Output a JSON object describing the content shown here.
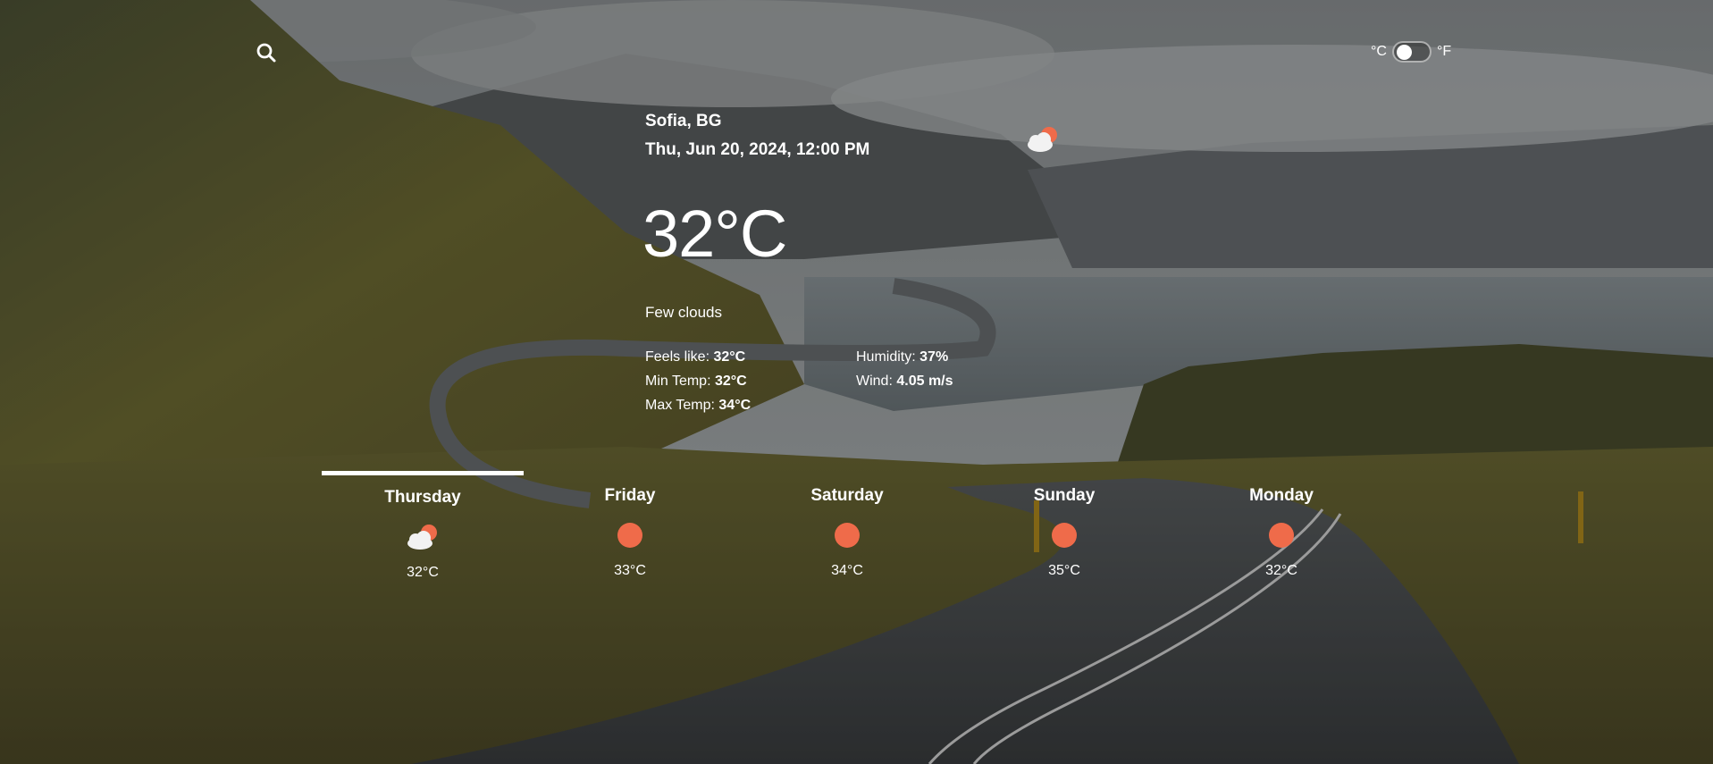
{
  "search": {
    "icon": "search-icon"
  },
  "units": {
    "celsius_label": "°C",
    "fahrenheit_label": "°F",
    "selected": "°C"
  },
  "current": {
    "location": "Sofia, BG",
    "datetime": "Thu, Jun 20, 2024, 12:00 PM",
    "icon": "sun-behind-cloud-icon",
    "temperature": "32°C",
    "description": "Few clouds",
    "details": {
      "feels_like_label": "Feels like:",
      "feels_like_value": "32°C",
      "min_temp_label": "Min Temp:",
      "min_temp_value": "32°C",
      "max_temp_label": "Max Temp:",
      "max_temp_value": "34°C",
      "humidity_label": "Humidity:",
      "humidity_value": "37%",
      "wind_label": "Wind:",
      "wind_value": "4.05 m/s"
    }
  },
  "forecast": [
    {
      "day": "Thursday",
      "temp": "32°C",
      "icon": "sun-behind-cloud-icon",
      "active": true
    },
    {
      "day": "Friday",
      "temp": "33°C",
      "icon": "sun-icon",
      "active": false
    },
    {
      "day": "Saturday",
      "temp": "34°C",
      "icon": "sun-icon",
      "active": false
    },
    {
      "day": "Sunday",
      "temp": "35°C",
      "icon": "sun-icon",
      "active": false
    },
    {
      "day": "Monday",
      "temp": "32°C",
      "icon": "sun-icon",
      "active": false
    }
  ],
  "colors": {
    "sun": "#ef6b4a",
    "cloud": "#f2f2f2",
    "text": "#ffffff"
  }
}
